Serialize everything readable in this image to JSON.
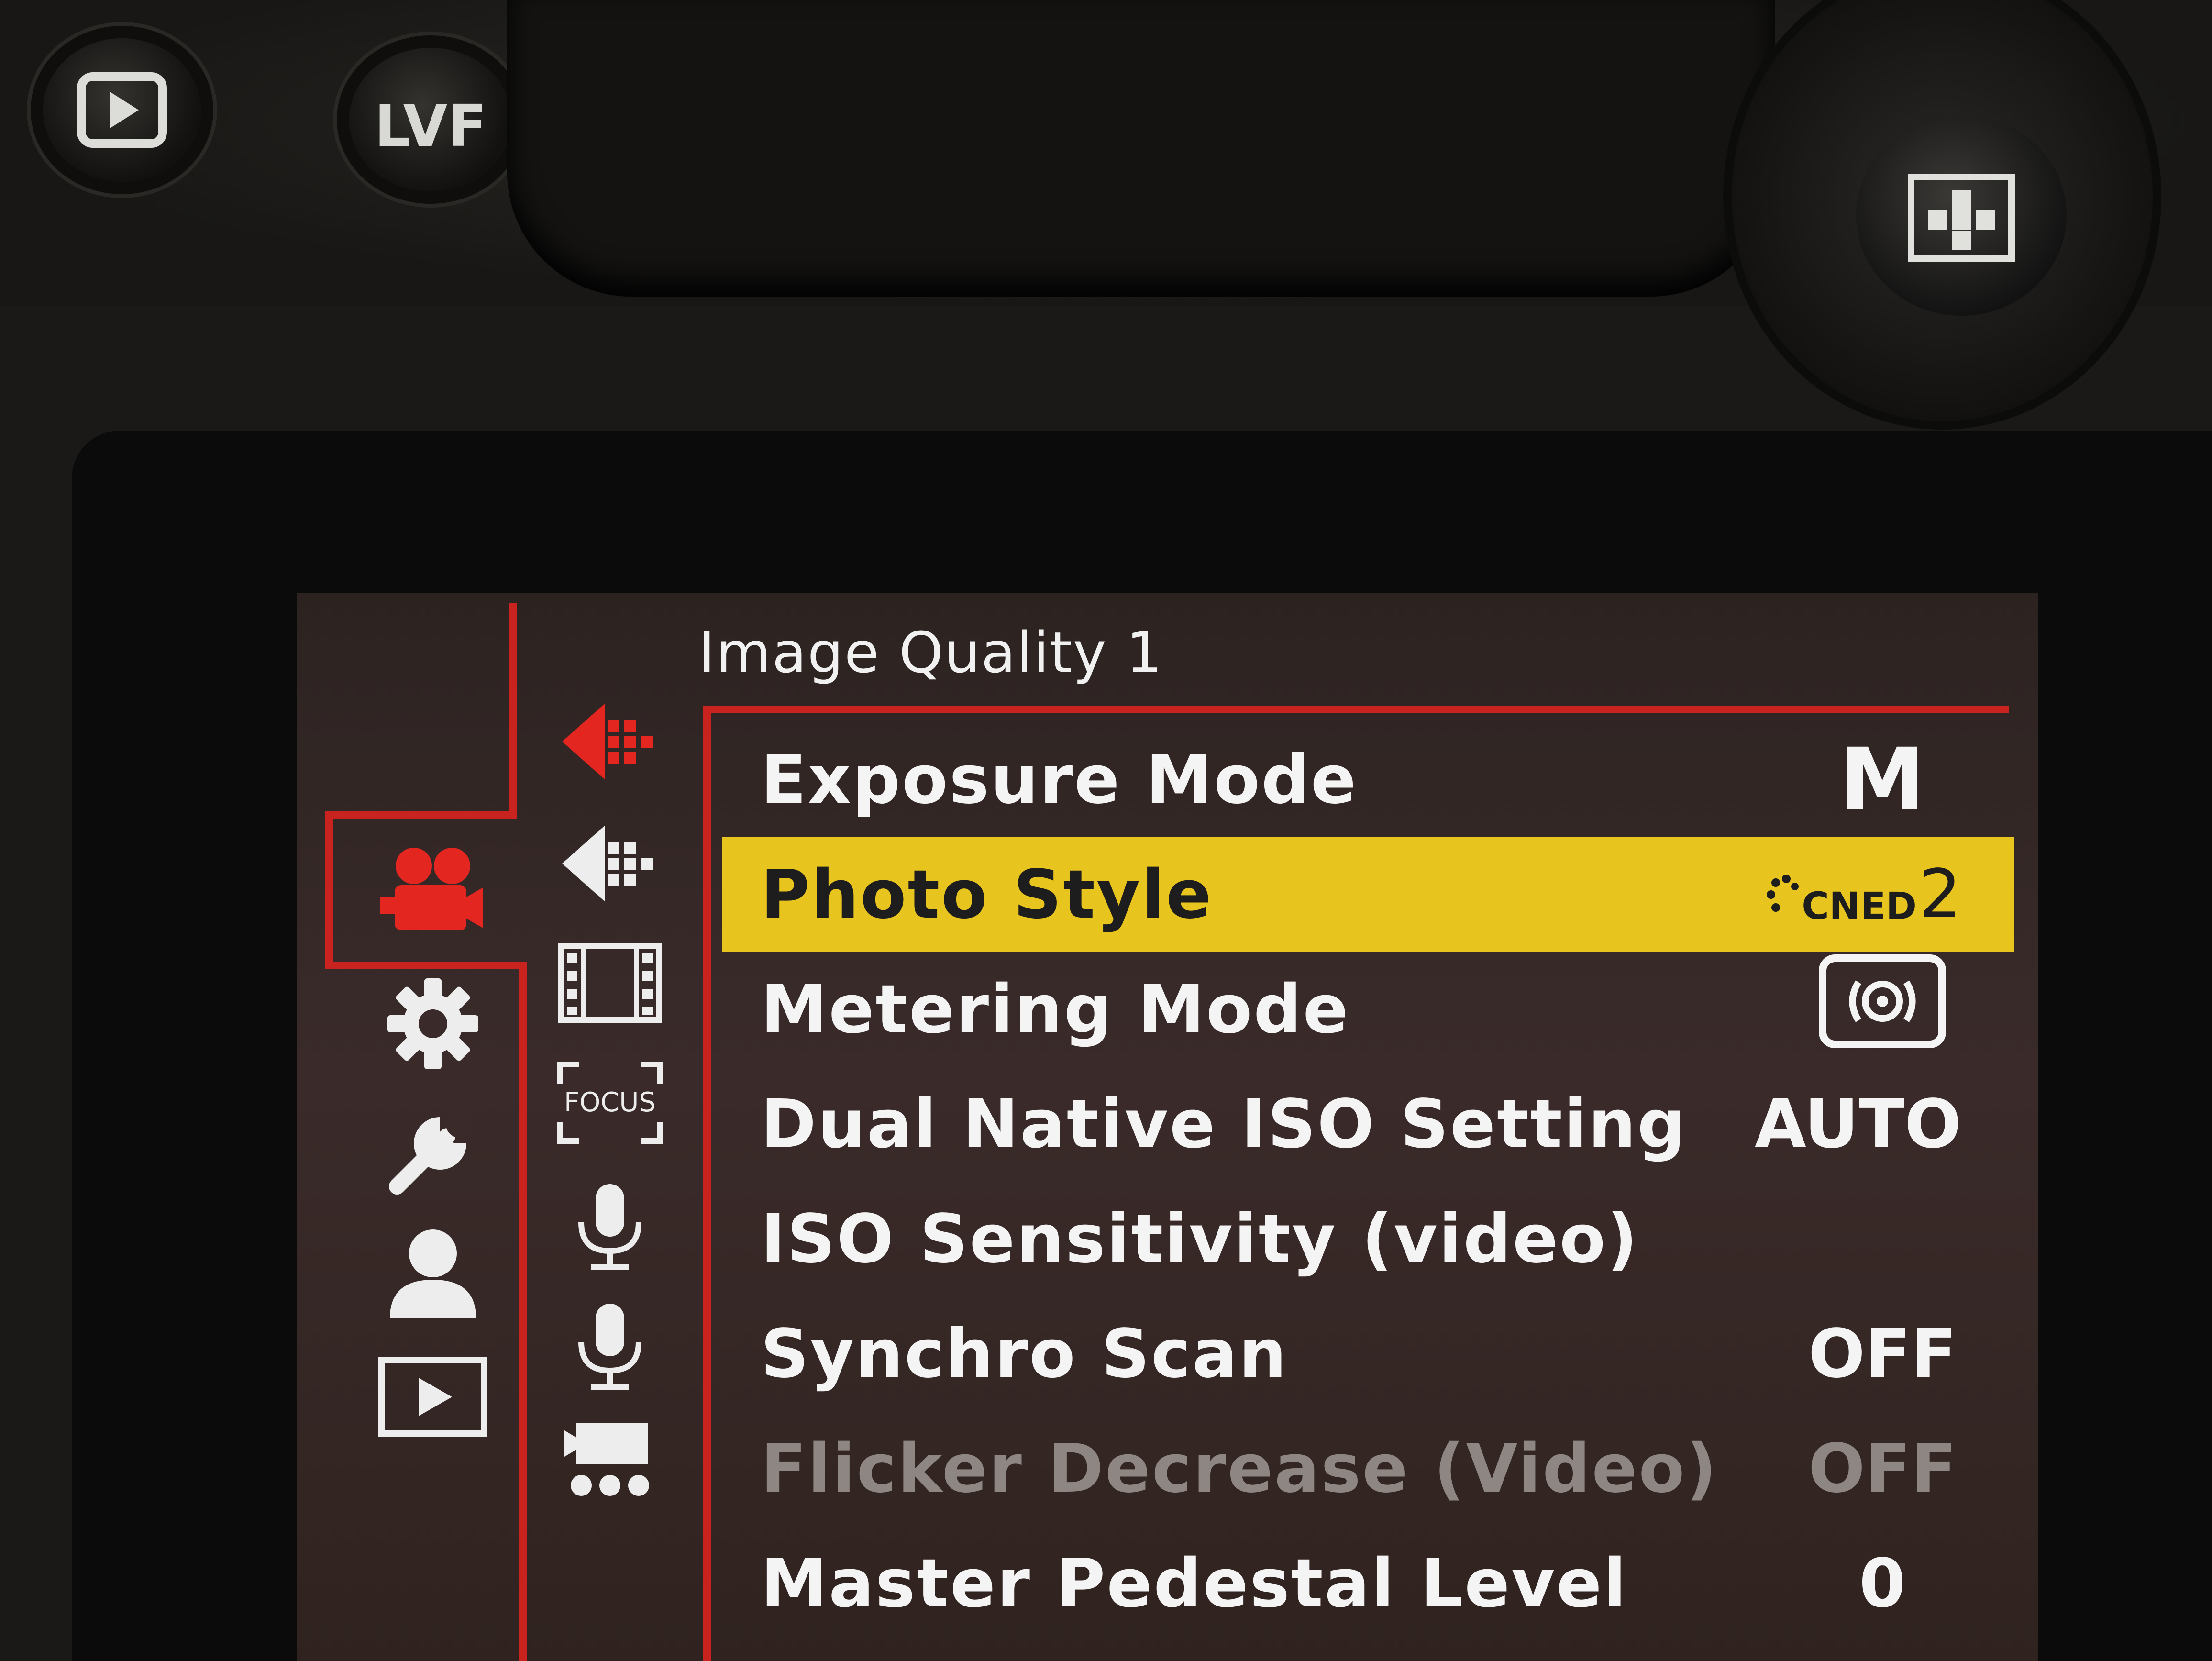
{
  "hardware": {
    "lvf_label": "LVF"
  },
  "icons": {
    "main_tabs": [
      "video-camera-icon",
      "gear-icon",
      "wrench-icon",
      "person-icon",
      "playback-icon"
    ],
    "sub_tabs": [
      "image-quality-1-icon",
      "image-quality-2-icon",
      "film-icon",
      "focus-icon",
      "microphone-icon",
      "microphone-2-icon",
      "video-dots-icon"
    ],
    "focus_label": "FOCUS"
  },
  "menu": {
    "title": "Image Quality 1",
    "items": [
      {
        "label": "Exposure Mode",
        "value": "M"
      },
      {
        "label": "Photo Style",
        "value": "CNED",
        "value_number": "2"
      },
      {
        "label": "Metering Mode",
        "value": "metering-multi-icon"
      },
      {
        "label": "Dual Native ISO Setting",
        "value": "AUTO"
      },
      {
        "label": "ISO Sensitivity (video)",
        "value": ""
      },
      {
        "label": "Synchro Scan",
        "value": "OFF"
      },
      {
        "label": "Flicker Decrease (Video)",
        "value": "OFF"
      },
      {
        "label": "Master Pedestal Level",
        "value": "0"
      }
    ]
  },
  "colors": {
    "accent_red": "#c8231f",
    "highlight_yellow": "#e8c41f",
    "text": "#f4f4f4",
    "disabled_text": "#8d8683"
  }
}
